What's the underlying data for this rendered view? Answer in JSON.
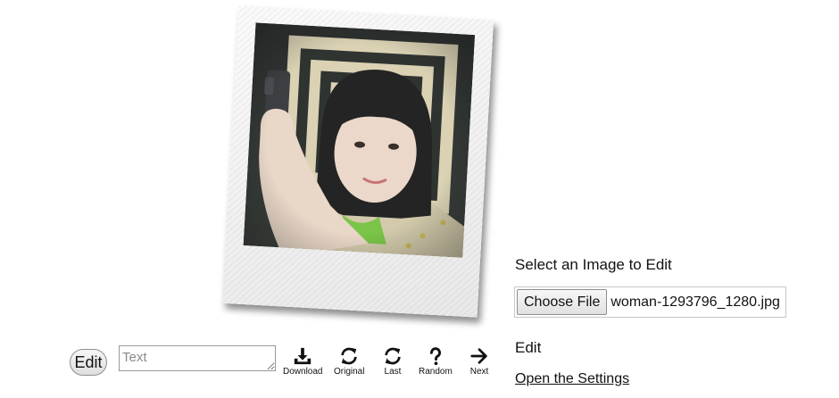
{
  "photo": {
    "alt": "woman taking selfie"
  },
  "toolbar": {
    "edit_label": "Edit",
    "text_placeholder": "Text",
    "text_value": "",
    "tools": [
      {
        "label": "Download",
        "icon": "download-icon"
      },
      {
        "label": "Original",
        "icon": "refresh-icon"
      },
      {
        "label": "Last",
        "icon": "refresh-icon"
      },
      {
        "label": "Random",
        "icon": "question-icon"
      },
      {
        "label": "Next",
        "icon": "arrow-right-icon"
      }
    ]
  },
  "panel": {
    "select_label": "Select an Image to Edit",
    "choose_button": "Choose File",
    "file_name": "woman-1293796_1280.jpg",
    "edit_label": "Edit",
    "settings_link": "Open the Settings"
  }
}
